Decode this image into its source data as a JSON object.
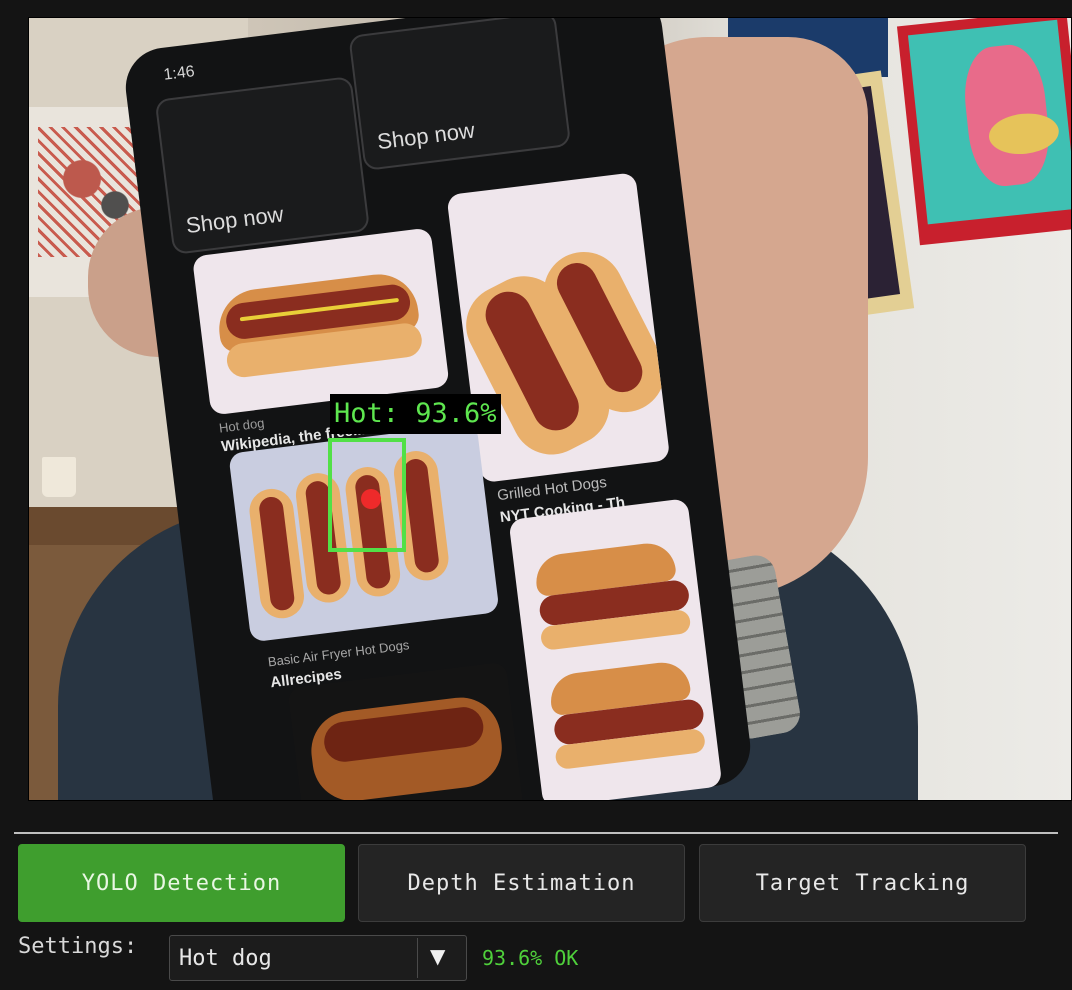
{
  "viewport": {
    "phone": {
      "status_time": "1:46",
      "shop_cards": [
        "Shop now",
        "Shop now"
      ],
      "results": [
        {
          "source": "Hot dog",
          "title": "Wikipedia, the free..."
        },
        {
          "source": "Grilled Hot Dogs",
          "title": "NYT Cooking - Th"
        },
        {
          "source": "Basic Air Fryer Hot Dogs",
          "title": "Allrecipes"
        }
      ]
    },
    "detection": {
      "label": "Hot: 93.6%",
      "color": "#52e047",
      "center_color": "#ee2a2a"
    }
  },
  "modes": {
    "yolo": "YOLO Detection",
    "depth": "Depth Estimation",
    "tracking": "Target Tracking",
    "active": "yolo",
    "active_color": "#3f9e2e"
  },
  "settings": {
    "label": "Settings:",
    "selected_class": "Hot dog",
    "status": "93.6% OK",
    "status_color": "#4fd03b"
  }
}
